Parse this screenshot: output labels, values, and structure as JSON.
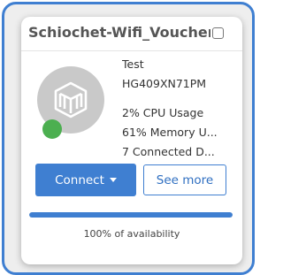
{
  "card": {
    "title": "Schiochet-Wifi_Voucher",
    "checkbox_checked": false,
    "device": {
      "name": "Test",
      "serial": "HG409XN71PM",
      "cpu_usage": "2% CPU Usage",
      "memory_usage": "61% Memory U...",
      "connected_devices": "7 Connected D..."
    },
    "status_color": "#4caf50",
    "logo_icon": "router-logo-icon",
    "buttons": {
      "connect_label": "Connect",
      "see_more_label": "See more"
    },
    "availability": {
      "fraction": 1.0,
      "label": "100% of availability"
    }
  },
  "colors": {
    "accent": "#3f7fd1",
    "status_online": "#4caf50",
    "logo_bg": "#c9c9c9"
  }
}
